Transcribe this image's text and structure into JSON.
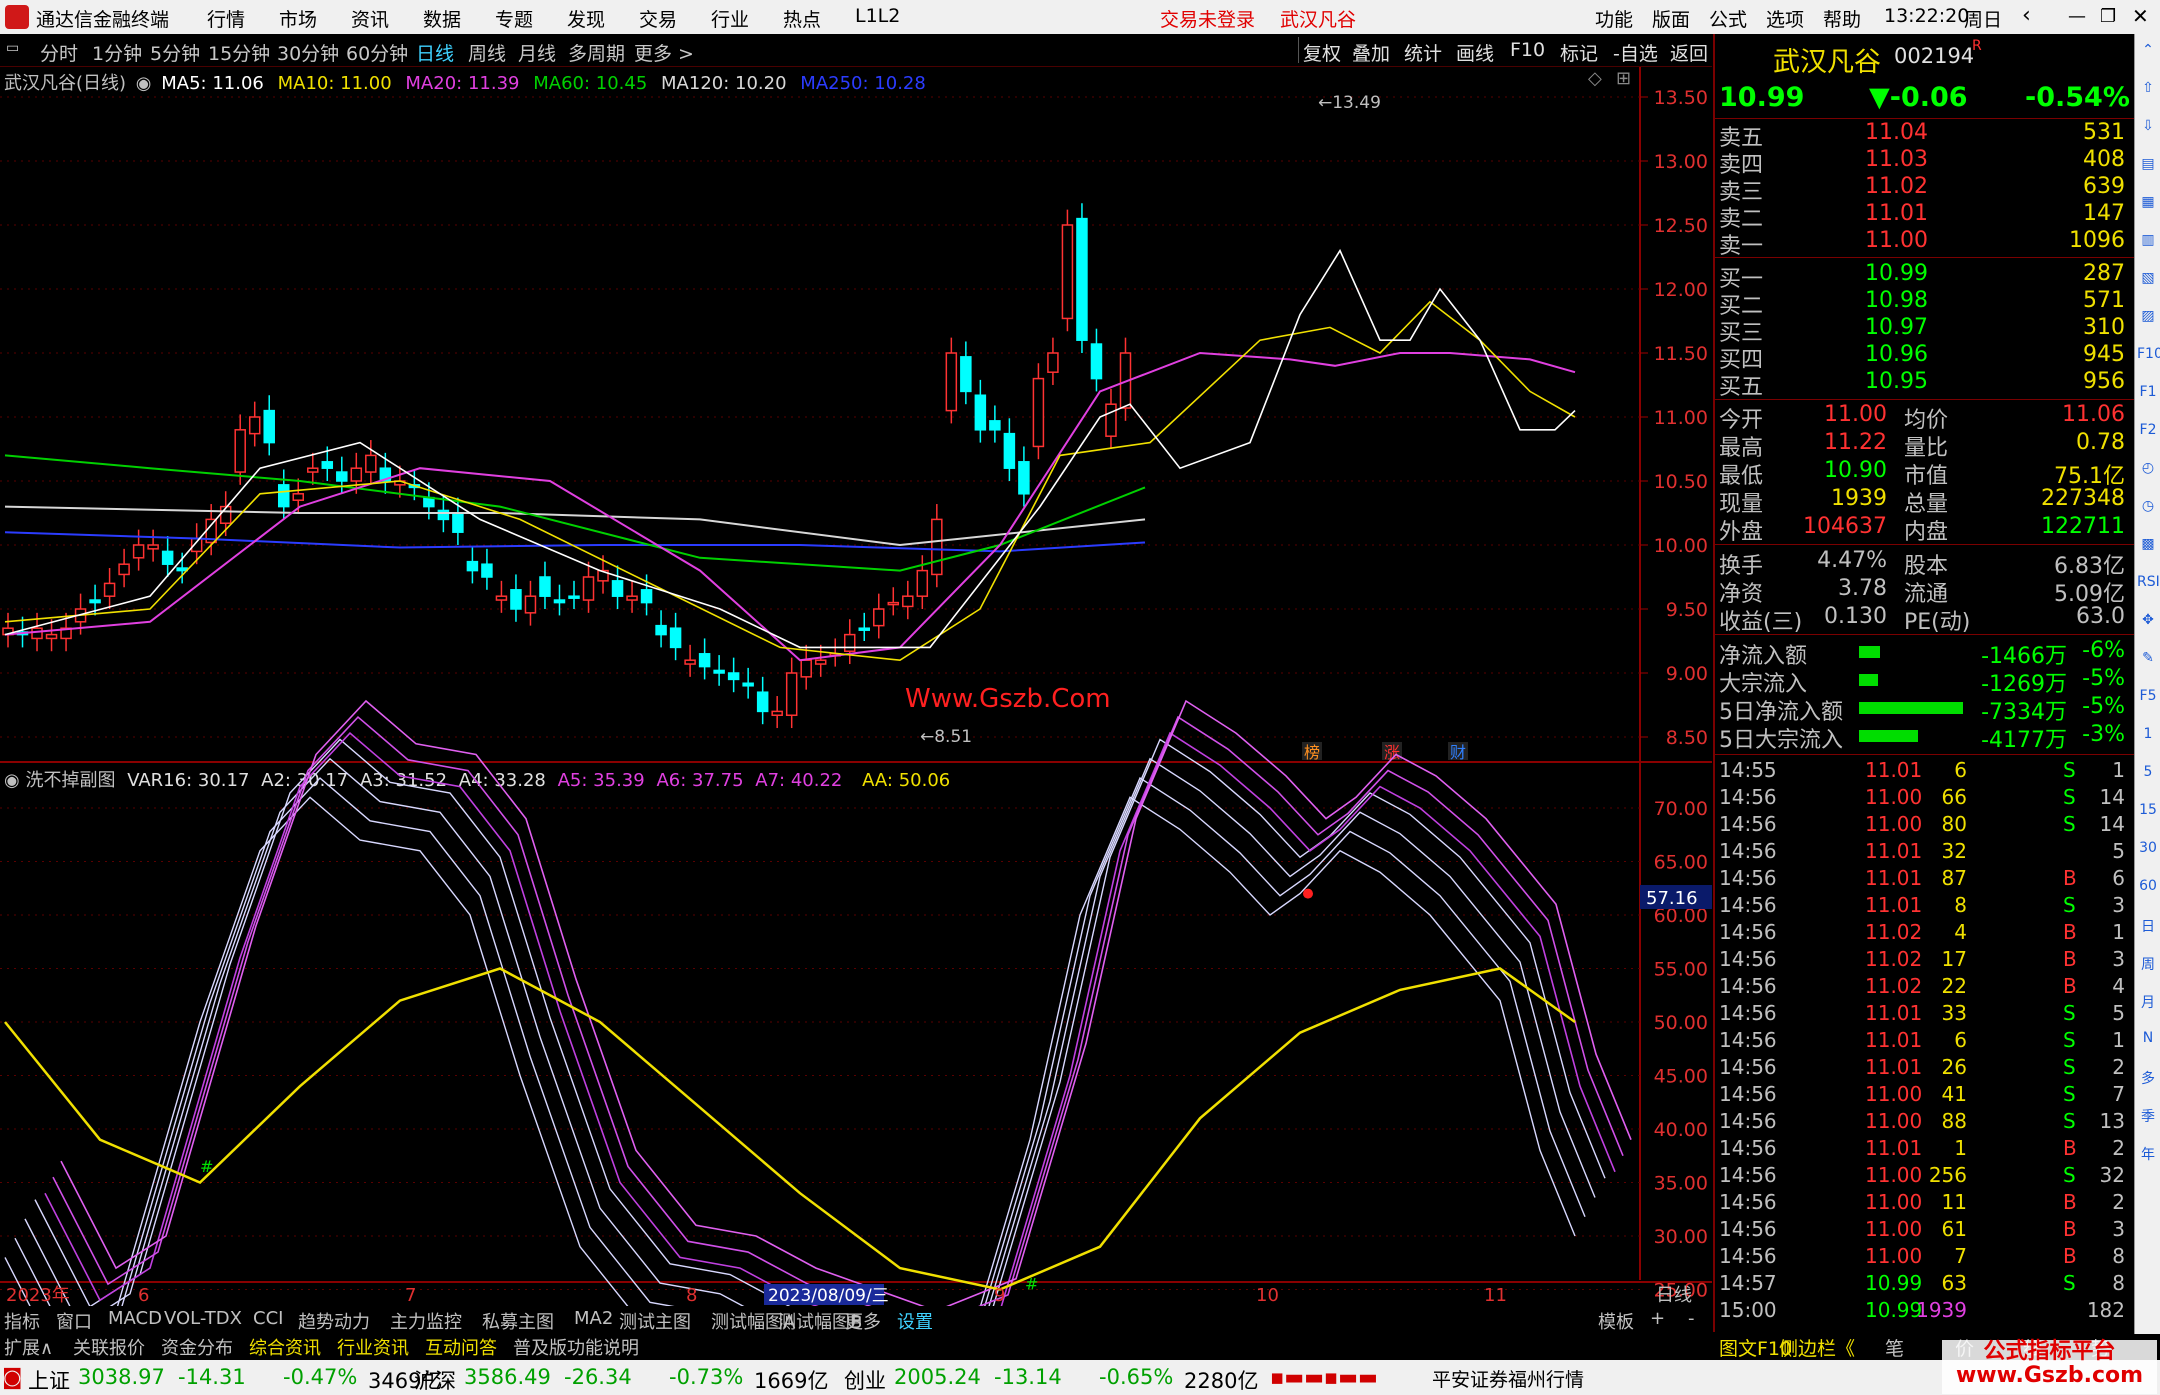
{
  "app": {
    "title": "通达信金融终端",
    "menu": [
      "行情",
      "市场",
      "资讯",
      "数据",
      "专题",
      "发现",
      "交易",
      "行业",
      "热点",
      "L1L2"
    ],
    "status_login": "交易未登录",
    "status_stock": "武汉凡谷",
    "right_menu": [
      "功能",
      "版面",
      "公式",
      "选项",
      "帮助"
    ],
    "time": "13:22:20",
    "weekday": "周日"
  },
  "toolbar": {
    "periods": [
      "分时",
      "1分钟",
      "5分钟",
      "15分钟",
      "30分钟",
      "60分钟",
      "日线",
      "周线",
      "月线",
      "多周期",
      "更多 >"
    ],
    "active": "日线",
    "right": [
      "复权",
      "叠加",
      "统计",
      "画线",
      "F10",
      "标记",
      "-自选",
      "返回"
    ]
  },
  "main_chart": {
    "title": "武汉凡谷(日线)",
    "ma": [
      {
        "label": "MA5: 11.06",
        "color": "#ffffff"
      },
      {
        "label": "MA10: 11.00",
        "color": "#f0e000"
      },
      {
        "label": "MA20: 11.39",
        "color": "#e040e0"
      },
      {
        "label": "MA60: 10.45",
        "color": "#00d000"
      },
      {
        "label": "MA120: 10.20",
        "color": "#d8d8d8"
      },
      {
        "label": "MA250: 10.28",
        "color": "#2b3cff"
      }
    ],
    "high_label": "13.49",
    "low_label": "8.51",
    "watermark": "Www.Gszb.Com",
    "markers": [
      "榜",
      "涨",
      "财"
    ],
    "yticks": [
      "13.50",
      "13.00",
      "12.50",
      "12.00",
      "11.50",
      "11.00",
      "10.50",
      "10.00",
      "9.50",
      "9.00",
      "8.50"
    ]
  },
  "sub_chart": {
    "title": "洗不掉副图",
    "vars": [
      {
        "label": "VAR16: 30.17",
        "color": "#e0e0e0"
      },
      {
        "label": "A2: 30.17",
        "color": "#e0e0e0"
      },
      {
        "label": "A3: 31.52",
        "color": "#e0e0e0"
      },
      {
        "label": "A4: 33.28",
        "color": "#e0e0e0"
      },
      {
        "label": "A5: 35.39",
        "color": "#e040e0"
      },
      {
        "label": "A6: 37.75",
        "color": "#e040e0"
      },
      {
        "label": "A7: 40.22",
        "color": "#e040e0"
      },
      {
        "label": "AA: 50.06",
        "color": "#f0e000"
      }
    ],
    "yticks": [
      "70.00",
      "65.00",
      "60.00",
      "55.00",
      "50.00",
      "45.00",
      "40.00",
      "35.00",
      "30.00",
      "25.00",
      "20.00"
    ],
    "current_value": "57.16"
  },
  "xaxis": {
    "labels": [
      "2023年",
      "6",
      "7",
      "8",
      "9",
      "10",
      "11"
    ],
    "selected_date": "2023/08/09/三",
    "period_label": "日线"
  },
  "bottom_tabs": [
    "指标",
    "窗口",
    "MACD",
    "VOL-TDX",
    "CCI",
    "趋势动力",
    "主力监控",
    "私募主图",
    "MA2",
    "测试主图",
    "测试幅图A",
    "测试幅图B",
    "更多",
    "设置"
  ],
  "bottom_tabs_right": [
    "模板",
    "+",
    "-"
  ],
  "bottom_tabs2": [
    "扩展∧",
    "关联报价",
    "资金分布",
    "综合资讯",
    "行业资讯",
    "互动问答",
    "普及版功能说明"
  ],
  "quote": {
    "name": "武汉凡谷",
    "code": "002194",
    "badge": "R",
    "price": "10.99",
    "change": "▼-0.06",
    "pct": "-0.54%",
    "asks": [
      {
        "l": "卖五",
        "p": "11.04",
        "v": "531"
      },
      {
        "l": "卖四",
        "p": "11.03",
        "v": "408"
      },
      {
        "l": "卖三",
        "p": "11.02",
        "v": "639"
      },
      {
        "l": "卖二",
        "p": "11.01",
        "v": "147"
      },
      {
        "l": "卖一",
        "p": "11.00",
        "v": "1096"
      }
    ],
    "bids": [
      {
        "l": "买一",
        "p": "10.99",
        "v": "287"
      },
      {
        "l": "买二",
        "p": "10.98",
        "v": "571"
      },
      {
        "l": "买三",
        "p": "10.97",
        "v": "310"
      },
      {
        "l": "买四",
        "p": "10.96",
        "v": "945"
      },
      {
        "l": "买五",
        "p": "10.95",
        "v": "956"
      }
    ],
    "stats": [
      [
        "今开",
        "11.00",
        "均价",
        "11.06"
      ],
      [
        "最高",
        "11.22",
        "量比",
        "0.78"
      ],
      [
        "最低",
        "10.90",
        "市值",
        "75.1亿"
      ],
      [
        "现量",
        "1939",
        "总量",
        "227348"
      ],
      [
        "外盘",
        "104637",
        "内盘",
        "122711"
      ]
    ],
    "stats2": [
      [
        "换手",
        "4.47%",
        "股本",
        "6.83亿"
      ],
      [
        "净资",
        "3.78",
        "流通",
        "5.09亿"
      ],
      [
        "收益(三)",
        "0.130",
        "PE(动)",
        "63.0"
      ]
    ],
    "flows": [
      {
        "l": "净流入额",
        "v": "-1466万",
        "p": "-6%",
        "w": 0.2
      },
      {
        "l": "大宗流入",
        "v": "-1269万",
        "p": "-5%",
        "w": 0.18
      },
      {
        "l": "5日净流入额",
        "v": "-7334万",
        "p": "-5%",
        "w": 1.0
      },
      {
        "l": "5日大宗流入",
        "v": "-4177万",
        "p": "-3%",
        "w": 0.57
      }
    ]
  },
  "ticks": [
    [
      "14:55",
      "11.01",
      "6",
      "S",
      "1"
    ],
    [
      "14:56",
      "11.00",
      "66",
      "S",
      "14"
    ],
    [
      "14:56",
      "11.00",
      "80",
      "S",
      "14"
    ],
    [
      "14:56",
      "11.01",
      "32",
      "",
      "5"
    ],
    [
      "14:56",
      "11.01",
      "87",
      "B",
      "6"
    ],
    [
      "14:56",
      "11.01",
      "8",
      "S",
      "3"
    ],
    [
      "14:56",
      "11.02",
      "4",
      "B",
      "1"
    ],
    [
      "14:56",
      "11.02",
      "17",
      "B",
      "3"
    ],
    [
      "14:56",
      "11.02",
      "22",
      "B",
      "4"
    ],
    [
      "14:56",
      "11.01",
      "33",
      "S",
      "5"
    ],
    [
      "14:56",
      "11.01",
      "6",
      "S",
      "1"
    ],
    [
      "14:56",
      "11.01",
      "26",
      "S",
      "2"
    ],
    [
      "14:56",
      "11.00",
      "41",
      "S",
      "7"
    ],
    [
      "14:56",
      "11.00",
      "88",
      "S",
      "13"
    ],
    [
      "14:56",
      "11.01",
      "1",
      "B",
      "2"
    ],
    [
      "14:56",
      "11.00",
      "256",
      "S",
      "32"
    ],
    [
      "14:56",
      "11.00",
      "11",
      "B",
      "2"
    ],
    [
      "14:56",
      "11.00",
      "61",
      "B",
      "3"
    ],
    [
      "14:56",
      "11.00",
      "7",
      "B",
      "8"
    ],
    [
      "14:57",
      "10.99",
      "63",
      "S",
      "8"
    ],
    [
      "15:00",
      "10.99",
      "1939",
      "",
      "182"
    ]
  ],
  "right_tabs": [
    "图文F10",
    "侧边栏《",
    "笔",
    "价",
    "细",
    "势"
  ],
  "vside": [
    "⌃",
    "⇧",
    "⇩",
    "▤",
    "▦",
    "▥",
    "▧",
    "▨",
    "F10",
    "F1",
    "F2",
    "◴",
    "◷",
    "▩",
    "RSI",
    "✥",
    "✎",
    "F5",
    "1",
    "5",
    "15",
    "30",
    "60",
    "日",
    "周",
    "月",
    "N",
    "多",
    "季",
    "年"
  ],
  "indices": [
    {
      "n": "上证",
      "p": "3038.97",
      "c": "-14.31",
      "pc": "-0.47%",
      "a": "3469亿"
    },
    {
      "n": "沪深",
      "p": "3586.49",
      "c": "-26.34",
      "pc": "-0.73%",
      "a": "1669亿"
    },
    {
      "n": "创业",
      "p": "2005.24",
      "c": "-13.14",
      "pc": "-0.65%",
      "a": "2280亿"
    }
  ],
  "broker": "平安证券福州行情",
  "watermark2": "公式指标平台\nwww.Gszb.com"
}
